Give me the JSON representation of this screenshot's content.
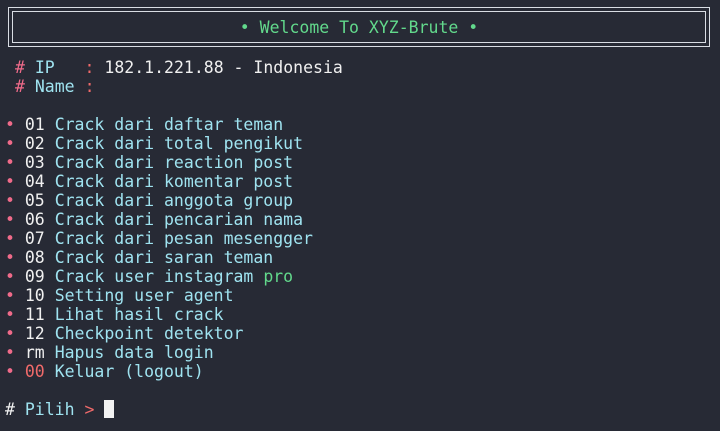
{
  "banner": {
    "title": "• Welcome To XYZ-Brute •"
  },
  "info": {
    "ip_label": "IP   ",
    "separator": ":",
    "ip_value": "182.1.221.88 - Indonesia",
    "name_label": "Name",
    "name_value": ""
  },
  "menu": [
    {
      "num": "01",
      "label": "Crack dari daftar teman",
      "suffix": ""
    },
    {
      "num": "02",
      "label": "Crack dari total pengikut",
      "suffix": ""
    },
    {
      "num": "03",
      "label": "Crack dari reaction post",
      "suffix": ""
    },
    {
      "num": "04",
      "label": "Crack dari komentar post",
      "suffix": ""
    },
    {
      "num": "05",
      "label": "Crack dari anggota group",
      "suffix": ""
    },
    {
      "num": "06",
      "label": "Crack dari pencarian nama",
      "suffix": ""
    },
    {
      "num": "07",
      "label": "Crack dari pesan mesengger",
      "suffix": ""
    },
    {
      "num": "08",
      "label": "Crack dari saran teman",
      "suffix": ""
    },
    {
      "num": "09",
      "label": "Crack user instagram ",
      "suffix": "pro"
    },
    {
      "num": "10",
      "label": "Setting user agent",
      "suffix": ""
    },
    {
      "num": "11",
      "label": "Lihat hasil crack",
      "suffix": ""
    },
    {
      "num": "12",
      "label": "Checkpoint detektor",
      "suffix": ""
    },
    {
      "num": "rm",
      "label": "Hapus data login",
      "suffix": ""
    },
    {
      "num": "00",
      "label": "Keluar (logout)",
      "suffix": ""
    }
  ],
  "prompt": {
    "hash": "#",
    "label": "Pilih",
    "arrow": ">"
  },
  "colors": {
    "background": "#272a35",
    "green": "#62d98c",
    "cyan": "#9fe3f0",
    "pink": "#f06b8a",
    "red": "#f06a6a"
  }
}
